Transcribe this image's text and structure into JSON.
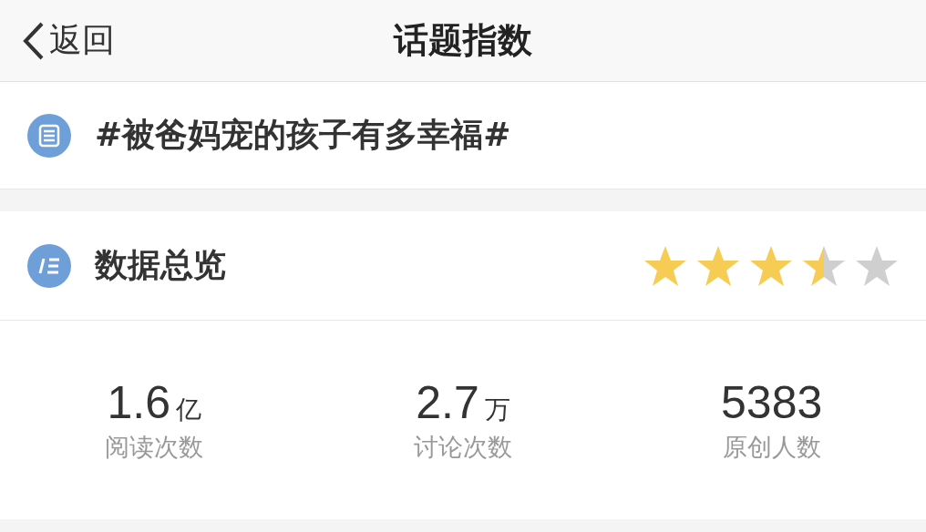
{
  "nav": {
    "back": "返回",
    "title": "话题指数"
  },
  "topic": {
    "title": "#被爸妈宠的孩子有多幸福#"
  },
  "overview": {
    "title": "数据总览",
    "stars": 3.5
  },
  "stats": [
    {
      "value": "1.6",
      "unit": "亿",
      "label": "阅读次数"
    },
    {
      "value": "2.7",
      "unit": "万",
      "label": "讨论次数"
    },
    {
      "value": "5383",
      "label": "原创人数"
    }
  ]
}
